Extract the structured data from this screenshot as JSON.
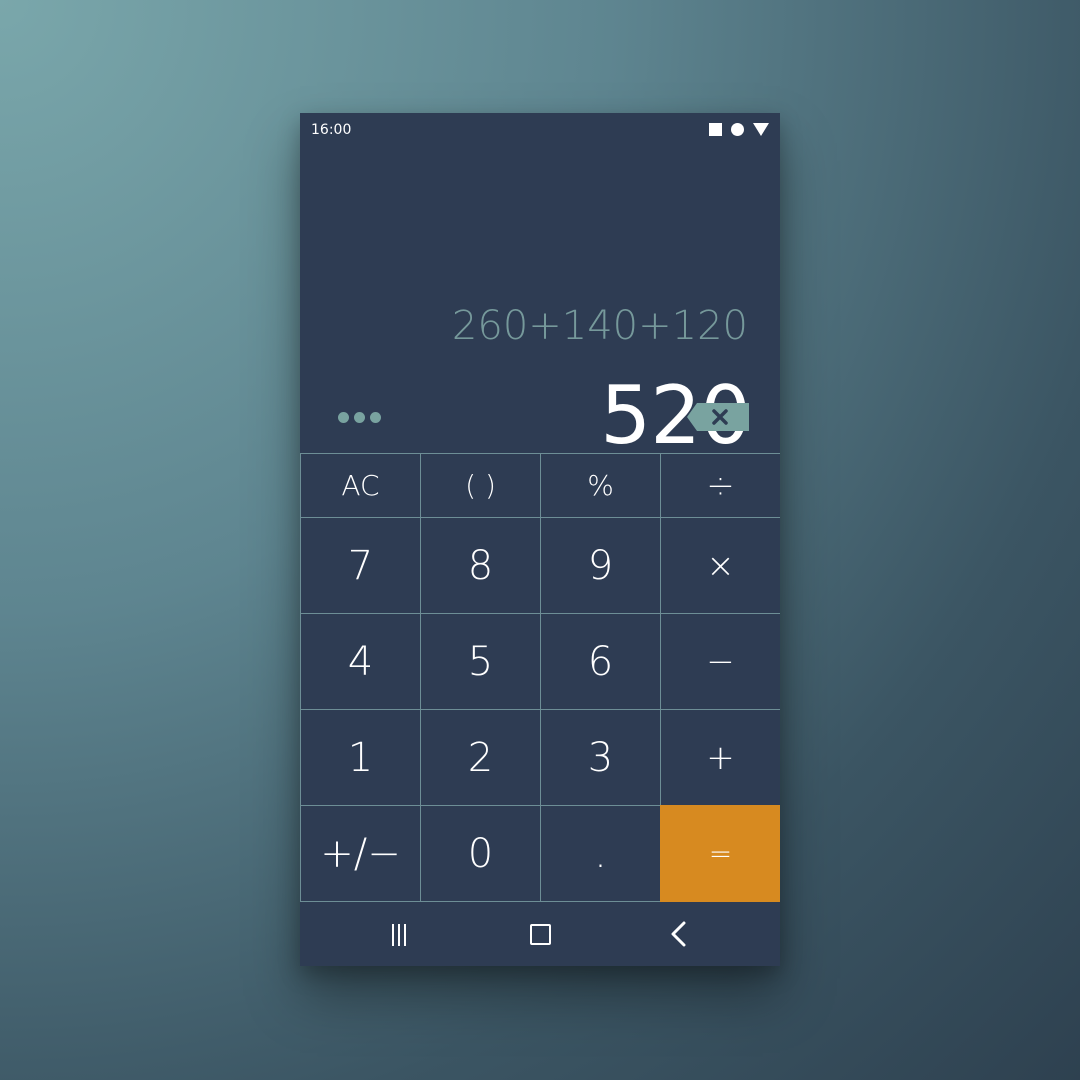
{
  "status_bar": {
    "time": "16:00",
    "icons": [
      "square-icon",
      "circle-icon",
      "triangle-icon"
    ]
  },
  "display": {
    "expression": "260+140+120",
    "result": "520"
  },
  "controls": {
    "more_icon": "more-dots-icon",
    "backspace_icon": "backspace-icon"
  },
  "keypad": {
    "row1": [
      "AC",
      "( )",
      "%",
      "÷"
    ],
    "row2": [
      "7",
      "8",
      "9",
      "×"
    ],
    "row3": [
      "4",
      "5",
      "6",
      "−"
    ],
    "row4": [
      "1",
      "2",
      "3",
      "+"
    ],
    "row5": [
      "+/−",
      "0",
      ".",
      "="
    ]
  },
  "nav_bar": {
    "icons": [
      "recents-icon",
      "home-icon",
      "back-icon"
    ]
  },
  "colors": {
    "background": "#2e3c53",
    "expression_text": "#76999b",
    "key_border": "#6d8e96",
    "equals_accent": "#d78a20"
  }
}
